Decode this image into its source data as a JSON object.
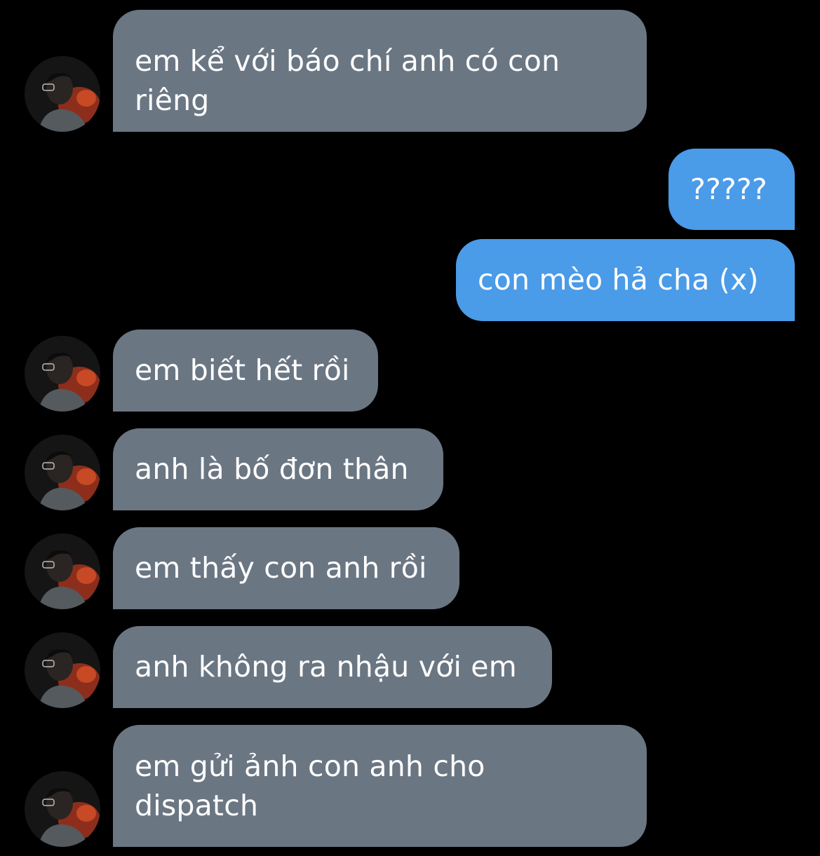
{
  "colors": {
    "background": "#000000",
    "incoming_bubble": "#6b7683",
    "outgoing_bubble": "#4a9be8",
    "text": "#ffffff"
  },
  "contact": {
    "avatar_icon": "profile-photo-avatar"
  },
  "messages": [
    {
      "direction": "incoming",
      "text": "em kể với báo chí anh có con riêng"
    },
    {
      "direction": "outgoing",
      "text": "?????"
    },
    {
      "direction": "outgoing",
      "text": "con mèo hả cha (x)"
    },
    {
      "direction": "incoming",
      "text": "em biết hết rồi"
    },
    {
      "direction": "incoming",
      "text": "anh là bố đơn thân"
    },
    {
      "direction": "incoming",
      "text": "em thấy con anh rồi"
    },
    {
      "direction": "incoming",
      "text": "anh không ra nhậu với em"
    },
    {
      "direction": "incoming",
      "text": "em gửi ảnh con anh cho dispatch"
    }
  ]
}
